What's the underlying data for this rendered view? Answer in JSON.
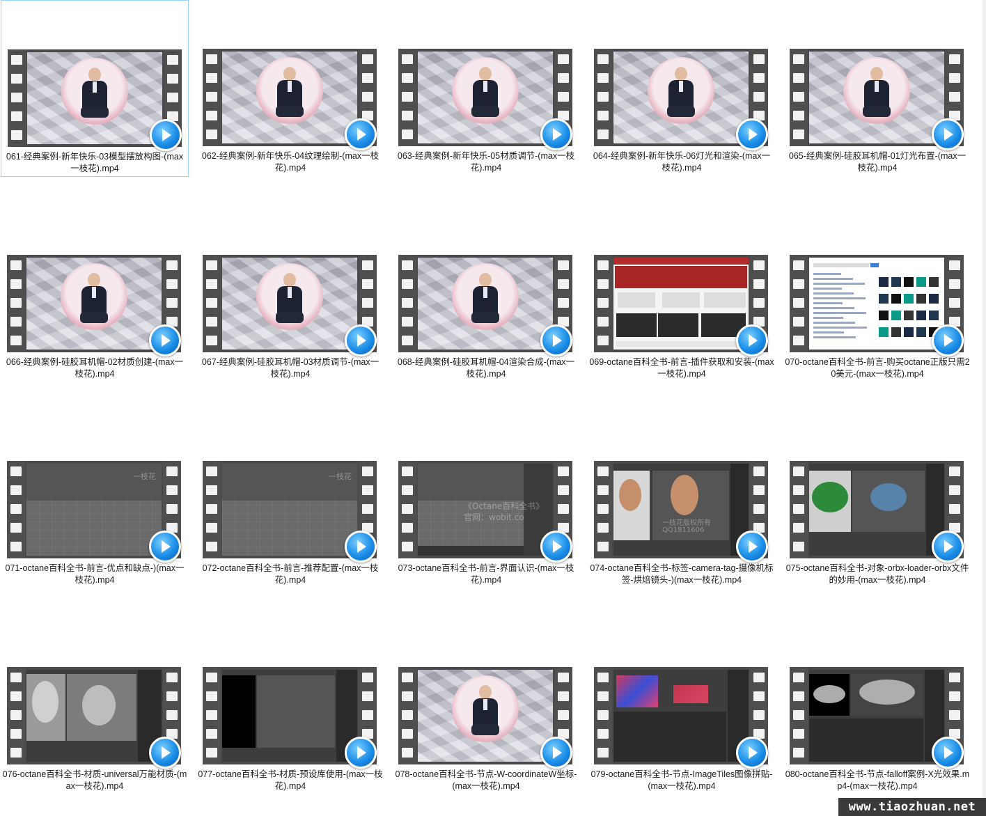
{
  "files": [
    {
      "name": "061-经典案例-新年快乐-03模型摆放构图-(max一枝花).mp4",
      "thumb": "collage",
      "selected": true
    },
    {
      "name": "062-经典案例-新年快乐-04纹理绘制-(max一枝花).mp4",
      "thumb": "collage"
    },
    {
      "name": "063-经典案例-新年快乐-05材质调节-(max一枝花).mp4",
      "thumb": "collage"
    },
    {
      "name": "064-经典案例-新年快乐-06灯光和渲染-(max一枝花).mp4",
      "thumb": "collage"
    },
    {
      "name": "065-经典案例-硅胶耳机帽-01灯光布置-(max一枝花).mp4",
      "thumb": "collage"
    },
    {
      "name": "066-经典案例-硅胶耳机帽-02材质创建-(max一枝花).mp4",
      "thumb": "collage"
    },
    {
      "name": "067-经典案例-硅胶耳机帽-03材质调节-(max一枝花).mp4",
      "thumb": "collage"
    },
    {
      "name": "068-经典案例-硅胶耳机帽-04渲染合成-(max一枝花).mp4",
      "thumb": "collage"
    },
    {
      "name": "069-octane百科全书-前言-插件获取和安装-(max一枝花).mp4",
      "thumb": "web-otoy"
    },
    {
      "name": "070-octane百科全书-前言-购买octane正版只需20美元-(max一枝花).mp4",
      "thumb": "web-search"
    },
    {
      "name": "071-octane百科全书-前言-优点和缺点-)(max一枝花).mp4",
      "thumb": "viewport"
    },
    {
      "name": "072-octane百科全书-前言-推荐配置-(max一枝花).mp4",
      "thumb": "viewport"
    },
    {
      "name": "073-octane百科全书-前言-界面认识-(max一枝花).mp4",
      "thumb": "viewport-ui"
    },
    {
      "name": "074-octane百科全书-标签-camera-tag-摄像机标签-烘焙镜头-)(max一枝花).mp4",
      "thumb": "heads"
    },
    {
      "name": "075-octane百科全书-对象-orbx-loader-orbx文件的妙用-(max一枝花).mp4",
      "thumb": "plant"
    },
    {
      "name": "076-octane百科全书-材质-universal万能材质-(max一枝花).mp4",
      "thumb": "groot"
    },
    {
      "name": "077-octane百科全书-材质-预设库使用-(max一枝花).mp4",
      "thumb": "dark-ui"
    },
    {
      "name": "078-octane百科全书-节点-W-coordinateW坐标-(max一枝花).mp4",
      "thumb": "collage"
    },
    {
      "name": "079-octane百科全书-节点-ImageTiles图像拼贴-(max一枝花).mp4",
      "thumb": "tiles"
    },
    {
      "name": "080-octane百科全书-节点-falloff案例-X光效果.mp4-(max一枝花).mp4",
      "thumb": "xray"
    }
  ],
  "watermark": "www.tiaozhuan.net",
  "thumb_watermarks": {
    "viewport": "一枝花",
    "viewport_ui_1": "《Octane百科全书》",
    "viewport_ui_2": "官网：wobit.co",
    "heads_1": "一枝花版权所有",
    "heads_2": "QQ1811606"
  },
  "icons": {
    "play_badge": "play-video-icon"
  }
}
